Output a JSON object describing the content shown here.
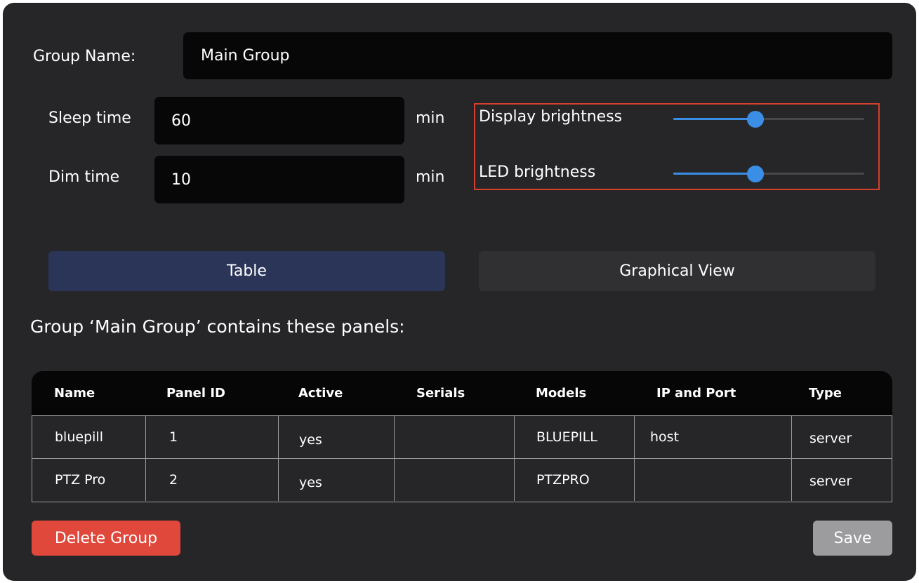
{
  "group": {
    "name_label": "Group Name:",
    "name_value": "Main Group"
  },
  "sleep": {
    "label": "Sleep time",
    "value": "60",
    "unit": "min"
  },
  "dim": {
    "label": "Dim time",
    "value": "10",
    "unit": "min"
  },
  "brightness": {
    "display_label": "Display brightness",
    "display_percent": 43,
    "led_label": "LED brightness",
    "led_percent": 43,
    "accent_color": "#3a8ee6",
    "highlight_color": "#d4402f"
  },
  "tabs": [
    {
      "label": "Table",
      "active": true
    },
    {
      "label": "Graphical View",
      "active": false
    }
  ],
  "panels_heading": "Group ‘Main Group’ contains these panels:",
  "table": {
    "headers": [
      "Name",
      "Panel ID",
      "Active",
      "Serials",
      "Models",
      "IP and Port",
      "Type"
    ],
    "rows": [
      [
        "bluepill",
        "1",
        "yes",
        "",
        "BLUEPILL",
        "host",
        "server"
      ],
      [
        "PTZ Pro",
        "2",
        "yes",
        "",
        "PTZPRO",
        "",
        "server"
      ]
    ]
  },
  "buttons": {
    "delete": "Delete Group",
    "save": "Save",
    "delete_color": "#e0483b"
  }
}
